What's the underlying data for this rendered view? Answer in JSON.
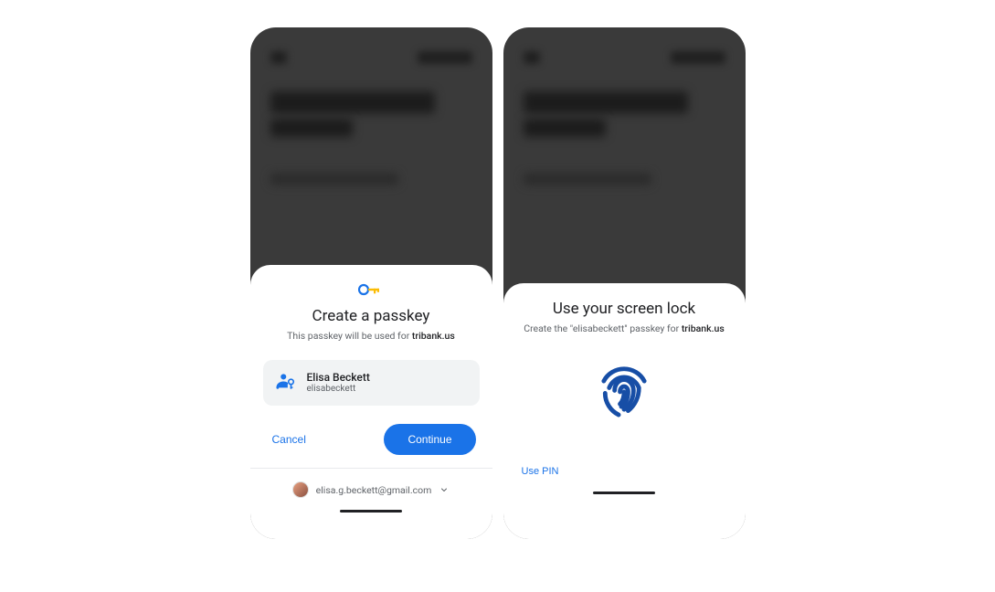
{
  "left": {
    "title": "Create a passkey",
    "subtitle_prefix": "This passkey will be used for ",
    "domain": "tribank.us",
    "account": {
      "name": "Elisa Beckett",
      "username": "elisabeckett"
    },
    "cancel_label": "Cancel",
    "continue_label": "Continue",
    "email": "elisa.g.beckett@gmail.com"
  },
  "right": {
    "title": "Use your screen lock",
    "subtitle_prefix": "Create the \"elisabeckett\" passkey for ",
    "domain": "tribank.us",
    "use_pin_label": "Use PIN"
  },
  "colors": {
    "primary": "#1a73e8"
  }
}
